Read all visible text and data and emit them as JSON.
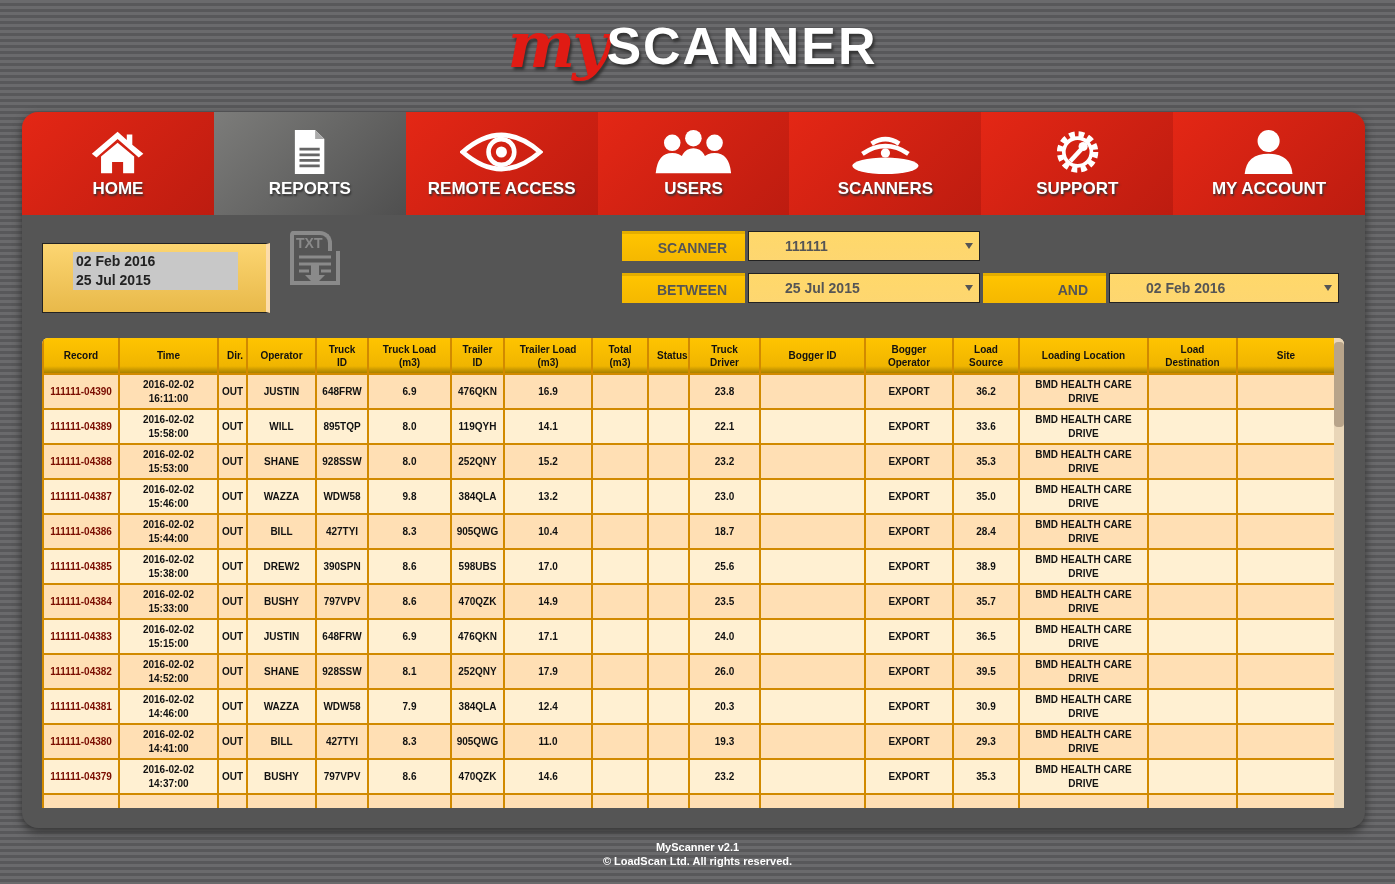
{
  "logo": {
    "script": "my",
    "word": "SCANNER"
  },
  "tabs": [
    {
      "label": "HOME",
      "kind": "home",
      "selected": false
    },
    {
      "label": "REPORTS",
      "kind": "reports",
      "selected": true
    },
    {
      "label": "REMOTE ACCESS",
      "kind": "remote",
      "selected": false
    },
    {
      "label": "USERS",
      "kind": "users",
      "selected": false
    },
    {
      "label": "SCANNERS",
      "kind": "scanners",
      "selected": false
    },
    {
      "label": "SUPPORT",
      "kind": "support",
      "selected": false
    },
    {
      "label": "MY ACCOUNT",
      "kind": "account",
      "selected": false
    }
  ],
  "date_summary": [
    "02 Feb 2016",
    "25 Jul 2015"
  ],
  "export": {
    "label": "TXT"
  },
  "filters": {
    "scanner_label": "SCANNER",
    "scanner_value": "111111",
    "between_label": "BETWEEN",
    "between_value": "25 Jul 2015",
    "and_label": "AND",
    "and_value": "02 Feb 2016"
  },
  "table": {
    "columns": [
      "Record",
      "Time",
      "Dir.",
      "Operator",
      "Truck ID",
      "Truck Load (m3)",
      "Trailer ID",
      "Trailer Load (m3)",
      "Total (m3)",
      "Status",
      "Truck Driver",
      "Bogger ID",
      "Bogger Operator",
      "Load Source",
      "Loading Location",
      "Load Destination",
      "Site"
    ],
    "rows": [
      [
        "111111-04390",
        "2016-02-02\n16:11:00",
        "OUT",
        "JUSTIN",
        "648FRW",
        "6.9",
        "476QKN",
        "16.9",
        null,
        null,
        "23.8",
        null,
        "EXPORT",
        "36.2",
        "BMD HEALTH CARE DRIVE",
        null,
        null
      ],
      [
        "111111-04389",
        "2016-02-02\n15:58:00",
        "OUT",
        "WILL",
        "895TQP",
        "8.0",
        "119QYH",
        "14.1",
        null,
        null,
        "22.1",
        null,
        "EXPORT",
        "33.6",
        "BMD HEALTH CARE DRIVE",
        null,
        null
      ],
      [
        "111111-04388",
        "2016-02-02\n15:53:00",
        "OUT",
        "SHANE",
        "928SSW",
        "8.0",
        "252QNY",
        "15.2",
        null,
        null,
        "23.2",
        null,
        "EXPORT",
        "35.3",
        "BMD HEALTH CARE DRIVE",
        null,
        null
      ],
      [
        "111111-04387",
        "2016-02-02\n15:46:00",
        "OUT",
        "WAZZA",
        "WDW58",
        "9.8",
        "384QLA",
        "13.2",
        null,
        null,
        "23.0",
        null,
        "EXPORT",
        "35.0",
        "BMD HEALTH CARE DRIVE",
        null,
        null
      ],
      [
        "111111-04386",
        "2016-02-02\n15:44:00",
        "OUT",
        "BILL",
        "427TYI",
        "8.3",
        "905QWG",
        "10.4",
        null,
        null,
        "18.7",
        null,
        "EXPORT",
        "28.4",
        "BMD HEALTH CARE DRIVE",
        null,
        null
      ],
      [
        "111111-04385",
        "2016-02-02\n15:38:00",
        "OUT",
        "DREW2",
        "390SPN",
        "8.6",
        "598UBS",
        "17.0",
        null,
        null,
        "25.6",
        null,
        "EXPORT",
        "38.9",
        "BMD HEALTH CARE DRIVE",
        null,
        null
      ],
      [
        "111111-04384",
        "2016-02-02\n15:33:00",
        "OUT",
        "BUSHY",
        "797VPV",
        "8.6",
        "470QZK",
        "14.9",
        null,
        null,
        "23.5",
        null,
        "EXPORT",
        "35.7",
        "BMD HEALTH CARE DRIVE",
        null,
        null
      ],
      [
        "111111-04383",
        "2016-02-02\n15:15:00",
        "OUT",
        "JUSTIN",
        "648FRW",
        "6.9",
        "476QKN",
        "17.1",
        null,
        null,
        "24.0",
        null,
        "EXPORT",
        "36.5",
        "BMD HEALTH CARE DRIVE",
        null,
        null
      ],
      [
        "111111-04382",
        "2016-02-02\n14:52:00",
        "OUT",
        "SHANE",
        "928SSW",
        "8.1",
        "252QNY",
        "17.9",
        null,
        null,
        "26.0",
        null,
        "EXPORT",
        "39.5",
        "BMD HEALTH CARE DRIVE",
        null,
        null
      ],
      [
        "111111-04381",
        "2016-02-02\n14:46:00",
        "OUT",
        "WAZZA",
        "WDW58",
        "7.9",
        "384QLA",
        "12.4",
        null,
        null,
        "20.3",
        null,
        "EXPORT",
        "30.9",
        "BMD HEALTH CARE DRIVE",
        null,
        null
      ],
      [
        "111111-04380",
        "2016-02-02\n14:41:00",
        "OUT",
        "BILL",
        "427TYI",
        "8.3",
        "905QWG",
        "11.0",
        null,
        null,
        "19.3",
        null,
        "EXPORT",
        "29.3",
        "BMD HEALTH CARE DRIVE",
        null,
        null
      ],
      [
        "111111-04379",
        "2016-02-02\n14:37:00",
        "OUT",
        "BUSHY",
        "797VPV",
        "8.6",
        "470QZK",
        "14.6",
        null,
        null,
        "23.2",
        null,
        "EXPORT",
        "35.3",
        "BMD HEALTH CARE DRIVE",
        null,
        null
      ]
    ]
  },
  "footer": [
    "MyScanner v2.1",
    "© LoadScan Ltd. All rights reserved."
  ]
}
